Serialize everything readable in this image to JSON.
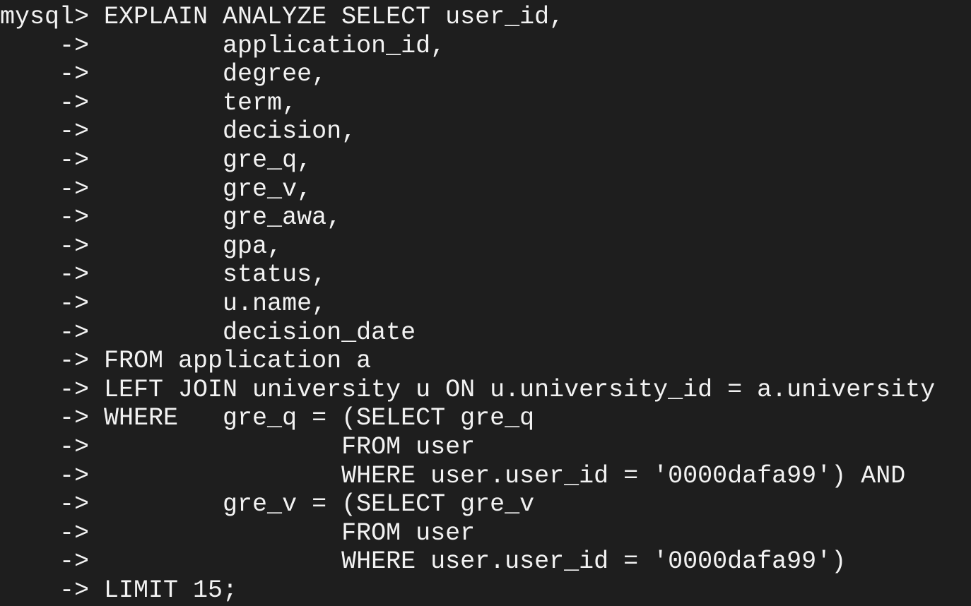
{
  "terminal": {
    "lines": [
      "mysql> EXPLAIN ANALYZE SELECT user_id,",
      "    ->         application_id,",
      "    ->         degree,",
      "    ->         term,",
      "    ->         decision,",
      "    ->         gre_q,",
      "    ->         gre_v,",
      "    ->         gre_awa,",
      "    ->         gpa,",
      "    ->         status,",
      "    ->         u.name,",
      "    ->         decision_date",
      "    -> FROM application a",
      "    -> LEFT JOIN university u ON u.university_id = a.university",
      "    -> WHERE   gre_q = (SELECT gre_q",
      "    ->                 FROM user",
      "    ->                 WHERE user.user_id = '0000dafa99') AND",
      "    ->         gre_v = (SELECT gre_v",
      "    ->                 FROM user",
      "    ->                 WHERE user.user_id = '0000dafa99')",
      "    -> LIMIT 15;"
    ],
    "colors": {
      "background": "#1e1e1e",
      "foreground": "#f2f2f2"
    }
  }
}
